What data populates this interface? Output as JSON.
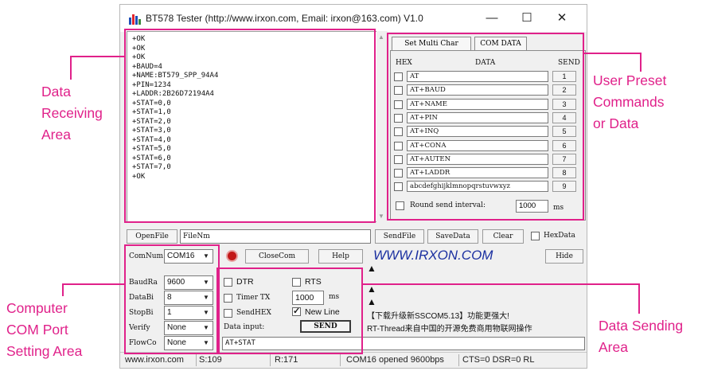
{
  "window": {
    "title": "BT578 Tester (http://www.irxon.com, Email: irxon@163.com) V1.0",
    "minimize": "—",
    "maximize": "☐",
    "close": "✕"
  },
  "receive": {
    "lines": [
      "+OK",
      "+OK",
      "+OK",
      "+BAUD=4",
      "+NAME:BT579_SPP_94A4",
      "+PIN=1234",
      "+LADDR:2B26D72194A4",
      "+STAT=0,0",
      "+STAT=1,0",
      "+STAT=2,0",
      "+STAT=3,0",
      "+STAT=4,0",
      "+STAT=5,0",
      "+STAT=6,0",
      "+STAT=7,0",
      "+OK"
    ]
  },
  "preset": {
    "tabs": [
      "Set Multi Char",
      "COM DATA"
    ],
    "header_hex": "HEX",
    "header_data": "DATA",
    "header_send": "SEND",
    "rows": [
      {
        "data": "AT",
        "send": "1"
      },
      {
        "data": "AT+BAUD",
        "send": "2"
      },
      {
        "data": "AT+NAME",
        "send": "3"
      },
      {
        "data": "AT+PIN",
        "send": "4"
      },
      {
        "data": "AT+INQ",
        "send": "5"
      },
      {
        "data": "AT+CONA",
        "send": "6"
      },
      {
        "data": "AT+AUTEN",
        "send": "7"
      },
      {
        "data": "AT+LADDR",
        "send": "8"
      },
      {
        "data": "abcdefghijklmnopqrstuvwxyz",
        "send": "9"
      }
    ],
    "round_label": "Round send interval:",
    "interval": "1000",
    "interval_unit": "ms"
  },
  "toolbar": {
    "open_file": "OpenFile",
    "filename": "FileNm",
    "send_file": "SendFile",
    "save_data": "SaveData",
    "clear": "Clear",
    "hex_data": "HexData"
  },
  "com": {
    "com_num_label": "ComNum",
    "com_num": "COM16",
    "close_com": "CloseCom",
    "help": "Help",
    "brand": "WWW.IRXON.COM",
    "hide": "Hide",
    "baud_label": "BaudRa",
    "baud": "9600",
    "databits_label": "DataBi",
    "databits": "8",
    "stopbits_label": "StopBi",
    "stopbits": "1",
    "verify_label": "Verify",
    "verify": "None",
    "flow_label": "FlowCo",
    "flow": "None"
  },
  "send": {
    "dtr": "DTR",
    "rts": "RTS",
    "timer_tx": "Timer TX",
    "timer_ms": "1000",
    "ms": "ms",
    "send_hex": "SendHEX",
    "new_line": "New Line",
    "data_input_label": "Data input:",
    "send_button": "SEND",
    "input_value": "AT+STAT",
    "up_arrow": "▲",
    "news_1": "【下载升级新SSCOM5.13】功能更强大!",
    "news_2": "RT-Thread来自中国的开源免费商用物联网操作"
  },
  "status": {
    "site": "www.irxon.com",
    "sent": "S:109",
    "received": "R:171",
    "port": "COM16 opened 9600bps",
    "lines": "CTS=0 DSR=0 RL"
  },
  "annotations": {
    "receive": [
      "Data",
      "Receiving",
      "Area"
    ],
    "preset": [
      "User Preset",
      "Commands",
      "or Data"
    ],
    "com_port": [
      "Computer",
      "COM Port",
      "Setting Area"
    ],
    "sending": [
      "Data Sending",
      "Area"
    ]
  },
  "colors": {
    "annotation": "#e0218a",
    "brand": "#1a2fa0",
    "check_accent": "#1a1a1a"
  }
}
